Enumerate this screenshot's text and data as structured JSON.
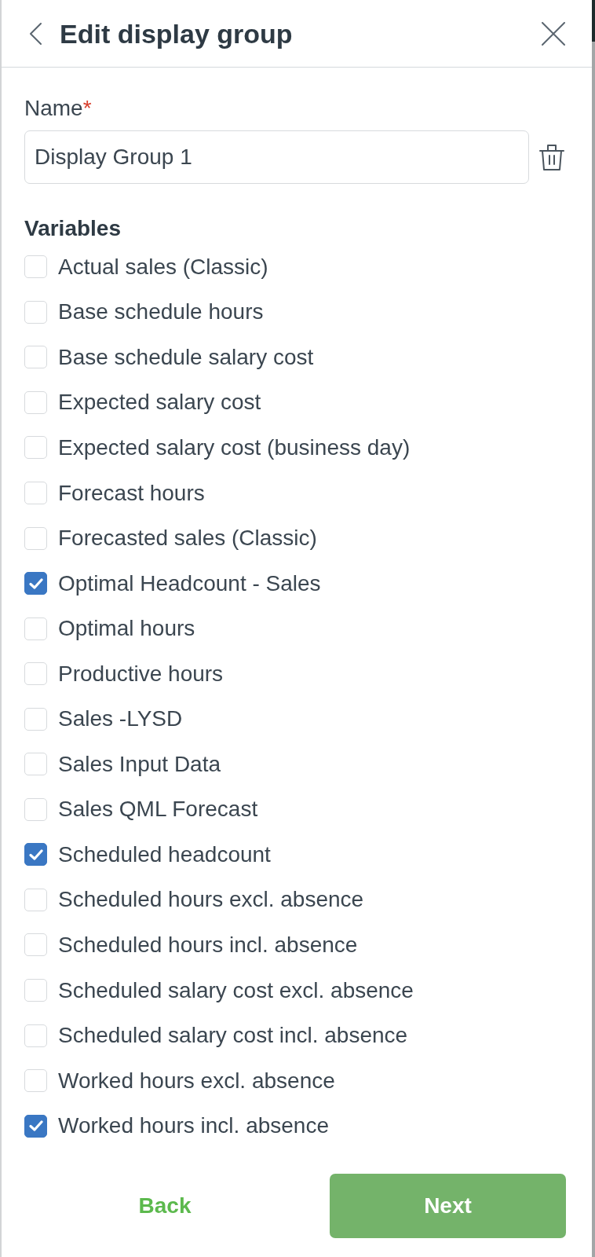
{
  "header": {
    "title": "Edit display group"
  },
  "name_field": {
    "label": "Name",
    "required_mark": "*",
    "value": "Display Group 1"
  },
  "variables": {
    "heading": "Variables",
    "items": [
      {
        "label": "Actual sales (Classic)",
        "checked": false
      },
      {
        "label": "Base schedule hours",
        "checked": false
      },
      {
        "label": "Base schedule salary cost",
        "checked": false
      },
      {
        "label": "Expected salary cost",
        "checked": false
      },
      {
        "label": "Expected salary cost (business day)",
        "checked": false
      },
      {
        "label": "Forecast hours",
        "checked": false
      },
      {
        "label": "Forecasted sales (Classic)",
        "checked": false
      },
      {
        "label": "Optimal Headcount - Sales",
        "checked": true
      },
      {
        "label": "Optimal hours",
        "checked": false
      },
      {
        "label": "Productive hours",
        "checked": false
      },
      {
        "label": "Sales -LYSD",
        "checked": false
      },
      {
        "label": "Sales Input Data",
        "checked": false
      },
      {
        "label": "Sales QML Forecast",
        "checked": false
      },
      {
        "label": "Scheduled headcount",
        "checked": true
      },
      {
        "label": "Scheduled hours excl. absence",
        "checked": false
      },
      {
        "label": "Scheduled hours incl. absence",
        "checked": false
      },
      {
        "label": "Scheduled salary cost excl. absence",
        "checked": false
      },
      {
        "label": "Scheduled salary cost incl. absence",
        "checked": false
      },
      {
        "label": "Worked hours excl. absence",
        "checked": false
      },
      {
        "label": "Worked hours incl. absence",
        "checked": true
      }
    ]
  },
  "footer": {
    "buttons": [
      {
        "label": "Back",
        "kind": "secondary"
      },
      {
        "label": "Next",
        "kind": "primary"
      }
    ]
  }
}
